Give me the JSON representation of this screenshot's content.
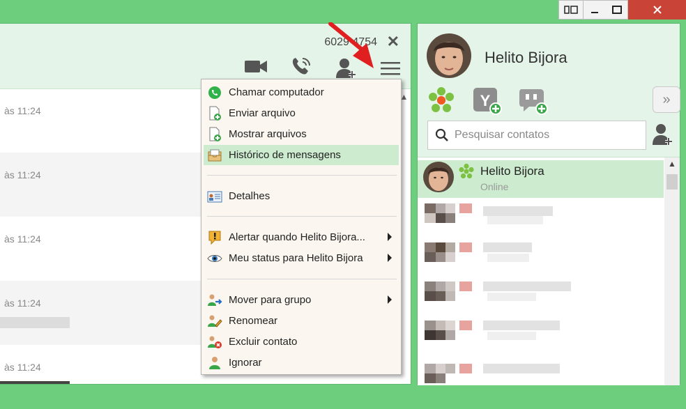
{
  "window_controls": {
    "tile_icon": "tile-icon",
    "minimize_icon": "minimize-icon",
    "maximize_icon": "maximize-icon",
    "close_icon": "close-icon"
  },
  "chat": {
    "number": "6029 4754",
    "close": "✕",
    "messages": [
      {
        "time": "às 11:24"
      },
      {
        "time": "às 11:24"
      },
      {
        "time": "às 11:24"
      },
      {
        "time": "às 11:24"
      },
      {
        "time": "às 11:24"
      }
    ],
    "colors": {
      "header_bg": "#e5f4e8",
      "alt_row": "#f4f4f4"
    }
  },
  "menu": {
    "items": [
      {
        "label": "Chamar computador",
        "icon": "phone-call-icon"
      },
      {
        "label": "Enviar arquivo",
        "icon": "send-file-icon"
      },
      {
        "label": "Mostrar arquivos",
        "icon": "show-files-icon"
      },
      {
        "label": "Histórico de mensagens",
        "icon": "message-history-icon"
      },
      {
        "label": "Detalhes",
        "icon": "details-icon"
      },
      {
        "label": "Alertar quando Helito Bijora...",
        "icon": "alert-icon"
      },
      {
        "label": "Meu status para Helito Bijora",
        "icon": "eye-icon"
      },
      {
        "label": "Mover para grupo",
        "icon": "move-group-icon"
      },
      {
        "label": "Renomear",
        "icon": "rename-icon"
      },
      {
        "label": "Excluir contato",
        "icon": "delete-contact-icon"
      },
      {
        "label": "Ignorar",
        "icon": "ignore-icon"
      }
    ],
    "highlight_color": "#cdeccf"
  },
  "profile": {
    "name": "Helito Bijora",
    "search_placeholder": "Pesquisar contatos",
    "protocols": [
      "icq-icon",
      "yahoo-add-icon",
      "gtalk-add-icon"
    ]
  },
  "contacts": {
    "selected": {
      "name": "Helito Bijora",
      "status": "Online"
    }
  },
  "accent": "#6dce7e"
}
